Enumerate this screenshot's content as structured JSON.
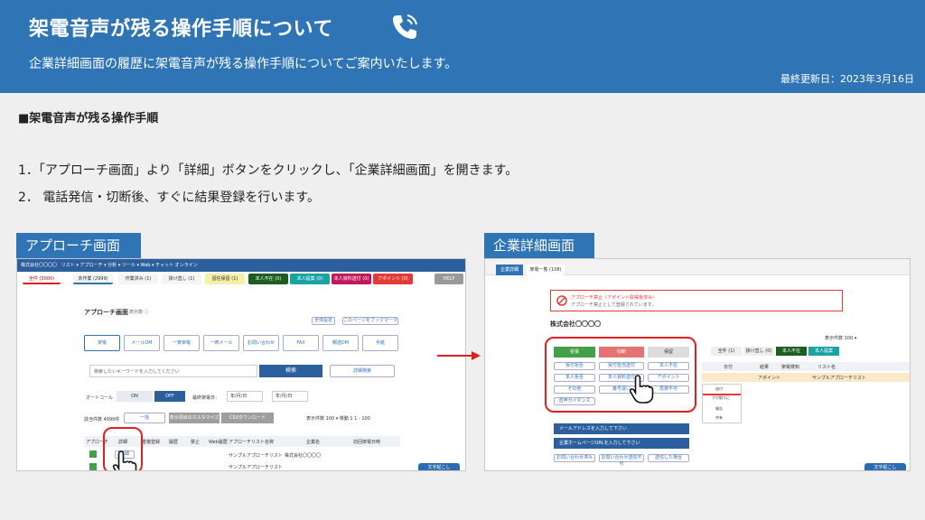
{
  "header": {
    "title": "架電音声が残る操作手順について",
    "subtitle": "企業詳細画面の履歴に架電音声が残る操作手順についてご案内いたします。",
    "updated": "最終更新日：2023年3月16日"
  },
  "section_title": "■架電音声が残る操作手順",
  "steps": [
    "1．「アプローチ画面」より「詳細」ボタンをクリックし、「企業詳細画面」を開きます。",
    "2．  電話発信・切断後、すぐに結果登録を行います。"
  ],
  "captions": {
    "left": "アプローチ画面",
    "right": "企業詳細画面"
  },
  "left_shot": {
    "nav_company": "株式会社〇〇〇〇",
    "nav_items": "リスト ▾   アプローチ ▾   分析 ▾   ツール ▾   Web ▾   チャット   オンライン",
    "tabs": [
      "全件 (3000)",
      "未作業 (2999)",
      "作業済み (1)",
      "掛け直し (1)",
      "留任保留 (1)",
      "本人不在 (0)",
      "本人提案 (0)",
      "本人資料送付 (0)",
      "アポイント (0)",
      "HELP"
    ],
    "page_title": "アプローチ画面",
    "page_sub": "表示数 ⓘ",
    "buttons_top": [
      "全体設定",
      "このページをブックマーク"
    ],
    "channels": [
      "架電",
      "メールDM",
      "一斉架電",
      "一斉メール",
      "お問い合わせ",
      "FAX",
      "郵送DM",
      "手紙"
    ],
    "search_placeholder": "検索したいキーワードを入力してください",
    "search_btn": "検索",
    "detail_search": "詳細検索",
    "autocall_label": "オートコール",
    "on": "ON",
    "off": "OFF",
    "last_call_label": "最終架電日：",
    "date_placeholder": "年/月/日",
    "count_label": "該当件数 4999件",
    "bulk_label": "一括",
    "customize": "表示項目のカスタマイズ",
    "csv": "CSVダウンロード",
    "per_page": "表示件数 100 ▾   移動 1   1 - 100",
    "cols": [
      "アプローチ",
      "詳細",
      "重複登録",
      "履歴",
      "禁止",
      "Web履歴",
      "アプローチリスト名称",
      "企業名",
      "前回架電日時"
    ],
    "row_list": "サンプルアプローチリスト",
    "row_company": "株式会社〇〇〇〇",
    "row_btn": "詳細",
    "chat_btn": "文字起こし"
  },
  "right_shot": {
    "tabs": [
      "企業詳細",
      "架電一覧 (108)"
    ],
    "alert_title": "アプローチ禁止（アポイント取得後済み）",
    "alert_sub": "アプローチ禁止として登録されています。",
    "company": "株式会社〇〇〇〇",
    "result_tabs": [
      "受電",
      "切断",
      "保留"
    ],
    "result_buttons": [
      "受付拒否",
      "受付担当送付",
      "本人不在",
      "本人拒否",
      "本人資料送付",
      "アポイント",
      "その他",
      "番号違い",
      "再架不可",
      "音声ガイダンス"
    ],
    "mail_label": "メールアドレスを入力して下さい",
    "url_label": "企業ホームページURLを入力して下さい",
    "footer_btns": [
      "お問い合わせ済み",
      "お問い合わせ送信不可",
      "送信した場合"
    ],
    "side_tabs": [
      "全件 (1)",
      "掛け直し (0)",
      "本人不在",
      "本人提案"
    ],
    "side_cols": [
      "日付",
      "結果",
      "架電検知",
      "リスト名"
    ],
    "side_row": "アポイント",
    "side_list": "サンプルアプローチリスト",
    "dropdown": [
      "送付",
      "アポ取りに",
      "報告",
      "共有"
    ],
    "per_page": "表示件数 100 ▾",
    "chat_btn": "文字起こし"
  }
}
